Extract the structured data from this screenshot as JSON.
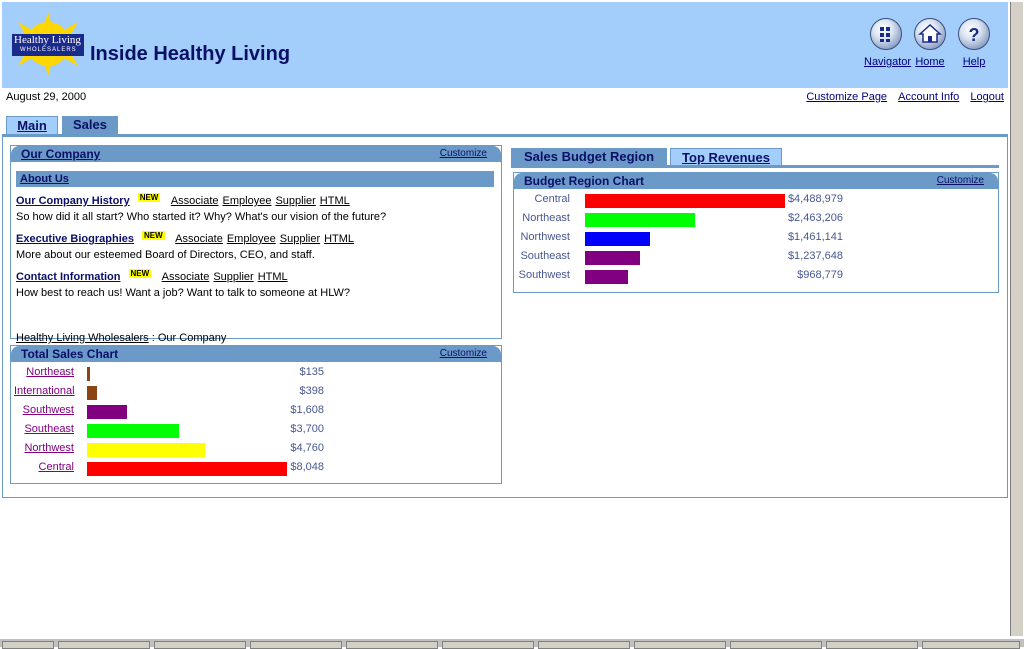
{
  "header": {
    "logo_text": "Healthy Living",
    "logo_subtext": "WHOLESALERS",
    "title": "Inside Healthy Living",
    "nav": [
      {
        "label": "Navigator",
        "icon": "navigator-icon"
      },
      {
        "label": "Home",
        "icon": "home-icon"
      },
      {
        "label": "Help",
        "icon": "help-icon"
      }
    ]
  },
  "topbar": {
    "date": "August 29, 2000",
    "links": [
      "Customize Page",
      "Account Info",
      "Logout"
    ]
  },
  "tabs": [
    "Main",
    "Sales"
  ],
  "our_company": {
    "title": "Our Company",
    "customize": "Customize",
    "section": "About Us",
    "items": [
      {
        "title": "Our Company History",
        "badge": "NEW",
        "links": [
          "Associate",
          "Employee",
          "Supplier",
          "HTML"
        ],
        "desc": "So how did it all start? Who started it? Why? What's our vision of the future?"
      },
      {
        "title": "Executive Biographies",
        "badge": "NEW",
        "links": [
          "Associate",
          "Employee",
          "Supplier",
          "HTML"
        ],
        "desc": "More about our esteemed Board of Directors, CEO, and staff."
      },
      {
        "title": "Contact Information",
        "badge": "NEW",
        "links": [
          "Associate",
          "Supplier",
          "HTML"
        ],
        "desc": "How best to reach us! Want a job? Want to talk to someone at HLW?"
      }
    ],
    "breadcrumb": {
      "link": "Healthy Living Wholesalers",
      "sep": ":",
      "current": "Our Company"
    }
  },
  "total_sales": {
    "title": "Total Sales Chart",
    "customize": "Customize"
  },
  "right_tabs": [
    "Sales Budget Region",
    "Top Revenues"
  ],
  "budget": {
    "title": "Budget Region Chart",
    "customize": "Customize"
  },
  "chart_data": [
    {
      "type": "bar",
      "title": "Total Sales Chart",
      "categories": [
        "Northeast",
        "International",
        "Southwest",
        "Southeast",
        "Northwest",
        "Central"
      ],
      "values": [
        135,
        398,
        1608,
        3700,
        4760,
        8048
      ],
      "labels": [
        "$135",
        "$398",
        "$1,608",
        "$3,700",
        "$4,760",
        "$8,048"
      ],
      "colors": [
        "#8b4513",
        "#8b4513",
        "#800080",
        "#00ff00",
        "#ffff00",
        "#ff0000"
      ]
    },
    {
      "type": "bar",
      "title": "Budget Region Chart",
      "categories": [
        "Central",
        "Northeast",
        "Northwest",
        "Southeast",
        "Southwest"
      ],
      "values": [
        4488979,
        2463206,
        1461141,
        1237648,
        968779
      ],
      "labels": [
        "$4,488,979",
        "$2,463,206",
        "$1,461,141",
        "$1,237,648",
        "$968,779"
      ],
      "colors": [
        "#ff0000",
        "#00ff00",
        "#0000ff",
        "#800080",
        "#800080"
      ]
    }
  ]
}
